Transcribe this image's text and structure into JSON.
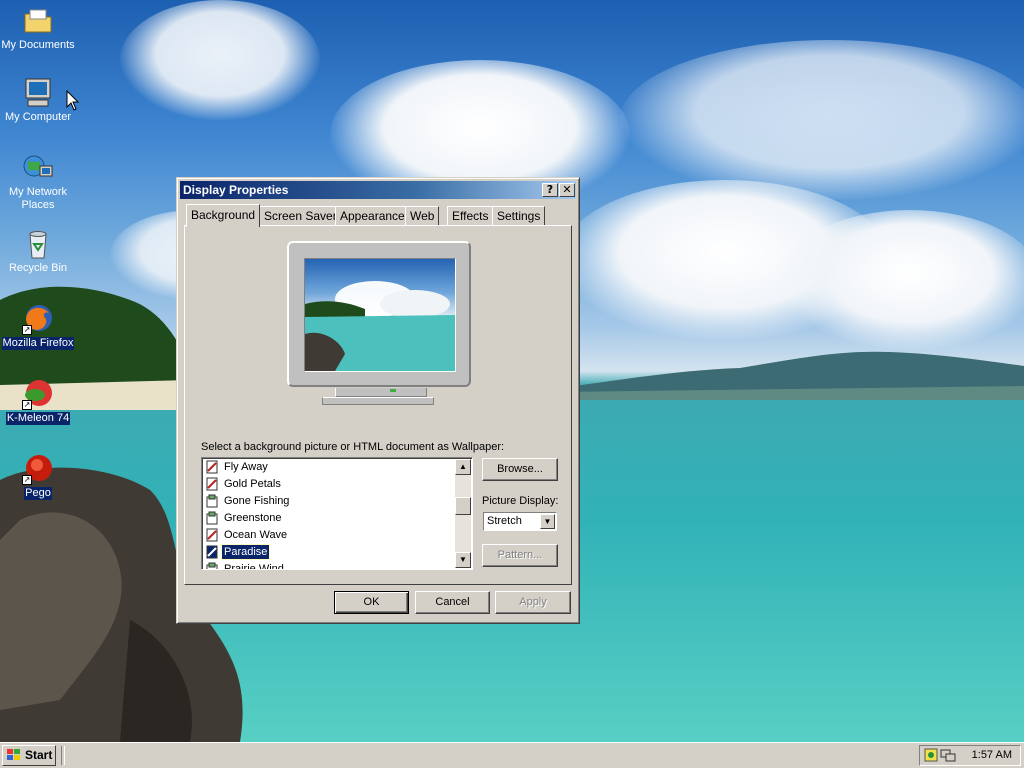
{
  "desktop": {
    "icons": [
      {
        "label": "My Documents",
        "icon": "folder-documents-icon"
      },
      {
        "label": "My Computer",
        "icon": "computer-icon"
      },
      {
        "label": "My Network Places",
        "icon": "network-places-icon"
      },
      {
        "label": "Recycle Bin",
        "icon": "recycle-bin-icon"
      },
      {
        "label": "Mozilla Firefox",
        "icon": "firefox-icon"
      },
      {
        "label": "K-Meleon 74",
        "icon": "k-meleon-icon"
      },
      {
        "label": "Pego",
        "icon": "pego-icon"
      }
    ],
    "colors": {
      "sky": "#2f74c4",
      "sea": "#34b3b5",
      "selection": "#0a246a"
    }
  },
  "window": {
    "title": "Display Properties",
    "help_button": "?",
    "close_button": "✕",
    "tabs": [
      {
        "label": "Background",
        "active": true
      },
      {
        "label": "Screen Saver",
        "active": false
      },
      {
        "label": "Appearance",
        "active": false
      },
      {
        "label": "Web",
        "active": false
      },
      {
        "label": "Effects",
        "active": false
      },
      {
        "label": "Settings",
        "active": false
      }
    ],
    "wallpaper_prompt": "Select a background picture or HTML document as Wallpaper:",
    "wallpaper_list": [
      {
        "label": "Fly Away",
        "selected": false
      },
      {
        "label": "Gold Petals",
        "selected": false
      },
      {
        "label": "Gone Fishing",
        "selected": false
      },
      {
        "label": "Greenstone",
        "selected": false
      },
      {
        "label": "Ocean Wave",
        "selected": false
      },
      {
        "label": "Paradise",
        "selected": true
      },
      {
        "label": "Prairie Wind",
        "selected": false
      }
    ],
    "browse_button": "Browse...",
    "picture_display_label": "Picture Display:",
    "picture_display_value": "Stretch",
    "pattern_button": "Pattern...",
    "ok_button": "OK",
    "cancel_button": "Cancel",
    "apply_button": "Apply"
  },
  "taskbar": {
    "start_label": "Start",
    "clock": "1:57 AM"
  }
}
